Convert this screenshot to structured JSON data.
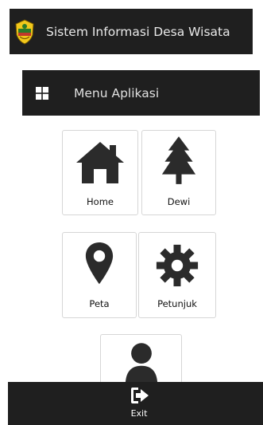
{
  "header": {
    "title": "Sistem Informasi Desa Wisata",
    "logo_icon": "regency-emblem-icon"
  },
  "menu": {
    "title": "Menu Aplikasi",
    "icon": "windows-icon"
  },
  "tiles": [
    {
      "label": "Home",
      "icon": "home-icon"
    },
    {
      "label": "Dewi",
      "icon": "pine-tree-icon"
    },
    {
      "label": "Peta",
      "icon": "map-marker-icon"
    },
    {
      "label": "Petunjuk",
      "icon": "gear-icon"
    },
    {
      "label": "",
      "icon": "user-icon"
    }
  ],
  "bottom_bar": {
    "exit_label": "Exit",
    "icon": "sign-out-icon"
  },
  "colors": {
    "bar_background": "#1f1f1f",
    "icon_color": "#2b2b2b",
    "emblem_yellow": "#f2c81b"
  }
}
